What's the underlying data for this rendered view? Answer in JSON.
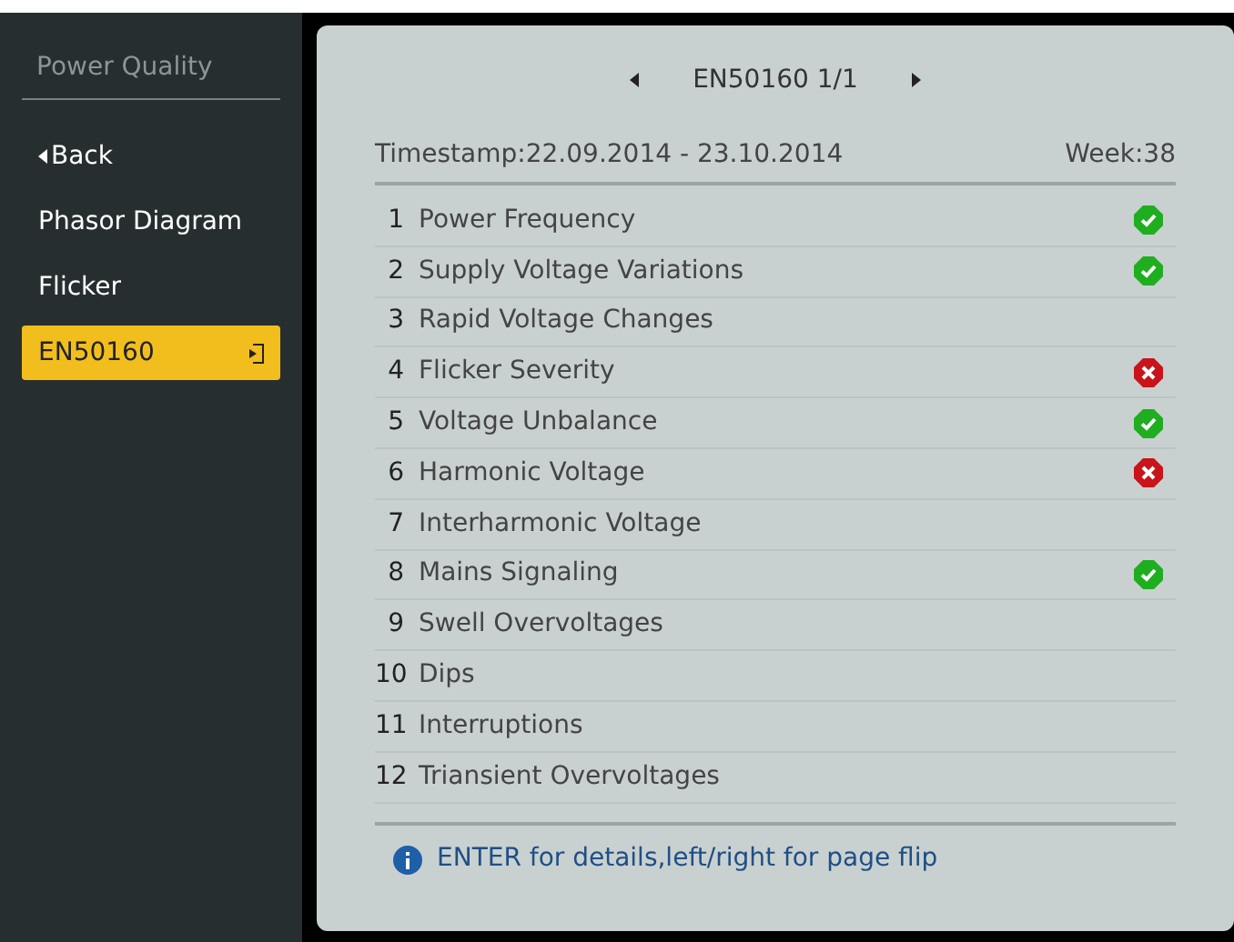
{
  "sidebar": {
    "title": "Power Quality",
    "items": [
      {
        "label": "Back",
        "kind": "back",
        "selected": false
      },
      {
        "label": "Phasor Diagram",
        "kind": "item",
        "selected": false
      },
      {
        "label": "Flicker",
        "kind": "item",
        "selected": false
      },
      {
        "label": "EN50160",
        "kind": "item",
        "selected": true
      }
    ]
  },
  "header": {
    "title": "EN50160 1/1"
  },
  "timestamp": "Timestamp:22.09.2014 - 23.10.2014",
  "week": "Week:38",
  "rows": [
    {
      "number": "1",
      "label": "Power Frequency",
      "kind": "pass"
    },
    {
      "number": "2",
      "label": "Supply Voltage Variations",
      "kind": "pass"
    },
    {
      "number": "3",
      "label": "Rapid Voltage Changes",
      "kind": "plain"
    },
    {
      "number": "4",
      "label": "Flicker Severity",
      "kind": "fail"
    },
    {
      "number": "5",
      "label": "Voltage Unbalance",
      "kind": "pass"
    },
    {
      "number": "6",
      "label": "Harmonic Voltage",
      "kind": "fail"
    },
    {
      "number": "7",
      "label": "Interharmonic Voltage",
      "kind": "plain"
    },
    {
      "number": "8",
      "label": "Mains Signaling",
      "kind": "pass"
    },
    {
      "number": "9",
      "label": "Swell Overvoltages",
      "kind": "plain"
    },
    {
      "number": "10",
      "label": "Dips",
      "kind": "plain"
    },
    {
      "number": "11",
      "label": "Interruptions",
      "kind": "plain"
    },
    {
      "number": "12",
      "label": "Triansient Overvoltages",
      "kind": "plain"
    }
  ],
  "hint": "ENTER for details,left/right for page flip"
}
